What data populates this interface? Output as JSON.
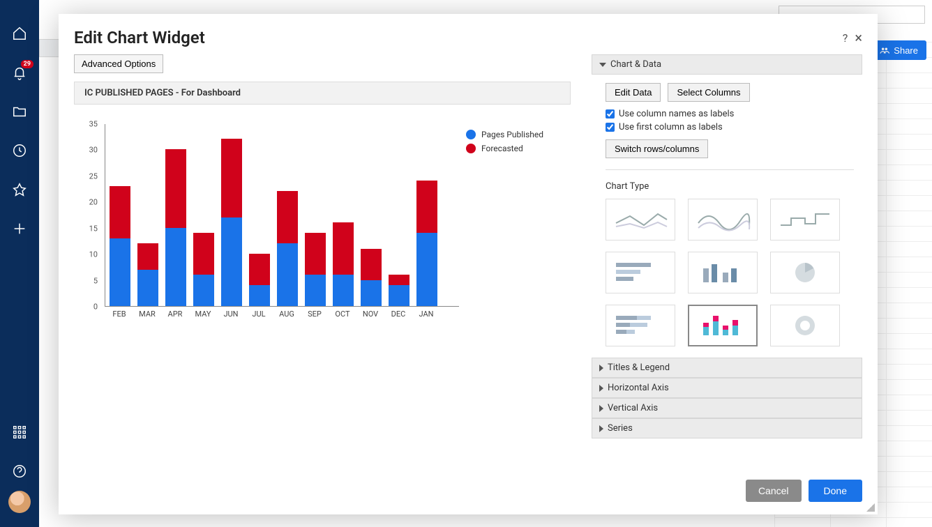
{
  "sidebar": {
    "notification_count": "29"
  },
  "share_label": "Share",
  "modal": {
    "title": "Edit Chart Widget",
    "advanced_options": "Advanced Options",
    "chart_title": "IC PUBLISHED PAGES - For Dashboard",
    "help_icon": "?",
    "close_icon": "×"
  },
  "panel": {
    "section_chart_data": "Chart & Data",
    "edit_data": "Edit Data",
    "select_columns": "Select Columns",
    "use_col_names": "Use column names as labels",
    "use_first_col": "Use first column as labels",
    "switch_rows": "Switch rows/columns",
    "chart_type_label": "Chart Type",
    "section_titles": "Titles & Legend",
    "section_haxis": "Horizontal Axis",
    "section_vaxis": "Vertical Axis",
    "section_series": "Series"
  },
  "footer": {
    "cancel": "Cancel",
    "done": "Done"
  },
  "chart_data": {
    "type": "bar",
    "stacked": true,
    "title": "IC PUBLISHED PAGES - For Dashboard",
    "xlabel": "",
    "ylabel": "",
    "ylim": [
      0,
      35
    ],
    "yticks": [
      0,
      5,
      10,
      15,
      20,
      25,
      30,
      35
    ],
    "categories": [
      "FEB",
      "MAR",
      "APR",
      "MAY",
      "JUN",
      "JUL",
      "AUG",
      "SEP",
      "OCT",
      "NOV",
      "DEC",
      "JAN"
    ],
    "series": [
      {
        "name": "Pages Published",
        "color": "#1a73e8",
        "values": [
          13,
          7,
          15,
          6,
          17,
          4,
          12,
          6,
          6,
          5,
          4,
          14
        ]
      },
      {
        "name": "Forecasted",
        "color": "#d0021b",
        "values": [
          10,
          5,
          15,
          8,
          15,
          6,
          10,
          8,
          10,
          6,
          2,
          10
        ]
      }
    ],
    "legend_position": "right"
  }
}
